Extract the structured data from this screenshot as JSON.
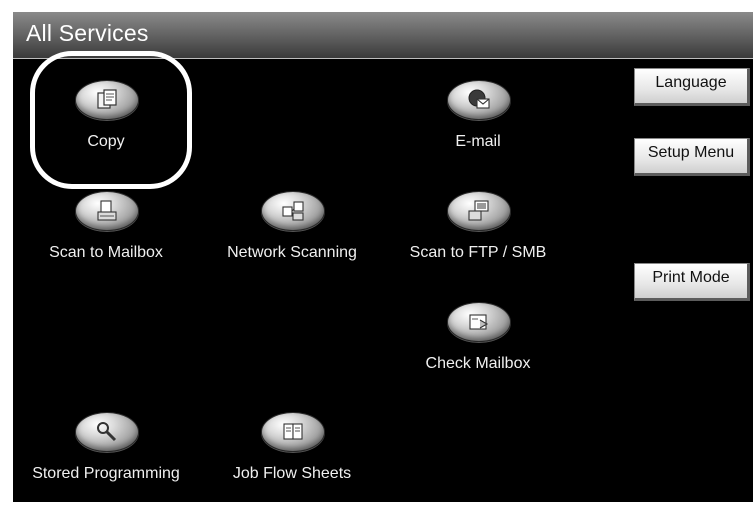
{
  "window": {
    "title": "All Services"
  },
  "services": [
    {
      "key": "copy",
      "label": "Copy",
      "icon": "copy-icon"
    },
    {
      "key": "email",
      "label": "E-mail",
      "icon": "email-icon"
    },
    {
      "key": "scan_mailbox",
      "label": "Scan to Mailbox",
      "icon": "scan-mailbox-icon"
    },
    {
      "key": "network_scanning",
      "label": "Network Scanning",
      "icon": "network-scanning-icon"
    },
    {
      "key": "scan_ftp",
      "label": "Scan to FTP / SMB",
      "icon": "scan-ftp-icon"
    },
    {
      "key": "check_mailbox",
      "label": "Check Mailbox",
      "icon": "check-mailbox-icon"
    },
    {
      "key": "stored_programming",
      "label": "Stored Programming",
      "icon": "stored-programming-icon"
    },
    {
      "key": "job_flow",
      "label": "Job Flow Sheets",
      "icon": "job-flow-icon"
    }
  ],
  "side_buttons": {
    "language": "Language",
    "setup_menu": "Setup Menu",
    "print_mode": "Print Mode"
  },
  "colors": {
    "background": "#000000",
    "title_bar": "#6a6a6a",
    "label_text": "#f0f0f0",
    "button_face": "#e7e7e7",
    "highlight": "#ffffff"
  }
}
